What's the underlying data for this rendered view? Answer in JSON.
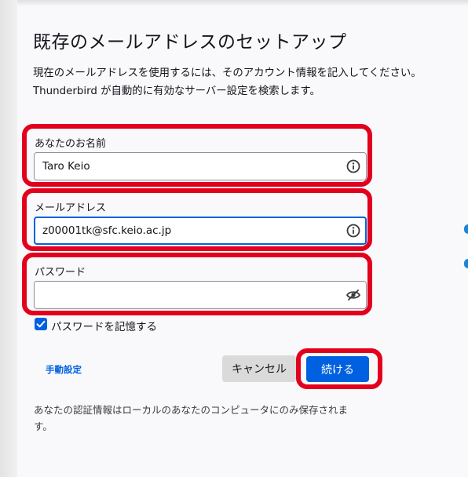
{
  "dialog": {
    "title": "既存のメールアドレスのセットアップ",
    "description_line1": "現在のメールアドレスを使用するには、そのアカウント情報を記入してください。",
    "description_line2": "Thunderbird が自動的に有効なサーバー設定を検索します。"
  },
  "form": {
    "name": {
      "label": "あなたのお名前",
      "value": "Taro Keio",
      "icon": "info-icon"
    },
    "email": {
      "label": "メールアドレス",
      "value": "z00001tk@sfc.keio.ac.jp",
      "icon": "info-icon"
    },
    "password": {
      "label": "パスワード",
      "value": "",
      "icon": "eye-slash-icon"
    },
    "remember_password": {
      "label": "パスワードを記憶する",
      "checked": true
    }
  },
  "actions": {
    "manual_config": "手動設定",
    "cancel": "キャンセル",
    "continue": "続ける"
  },
  "footnote": "あなたの認証情報はローカルのあなたのコンピュータにのみ保存されます。",
  "colors": {
    "accent": "#0061e0",
    "highlight": "#e2001d"
  }
}
